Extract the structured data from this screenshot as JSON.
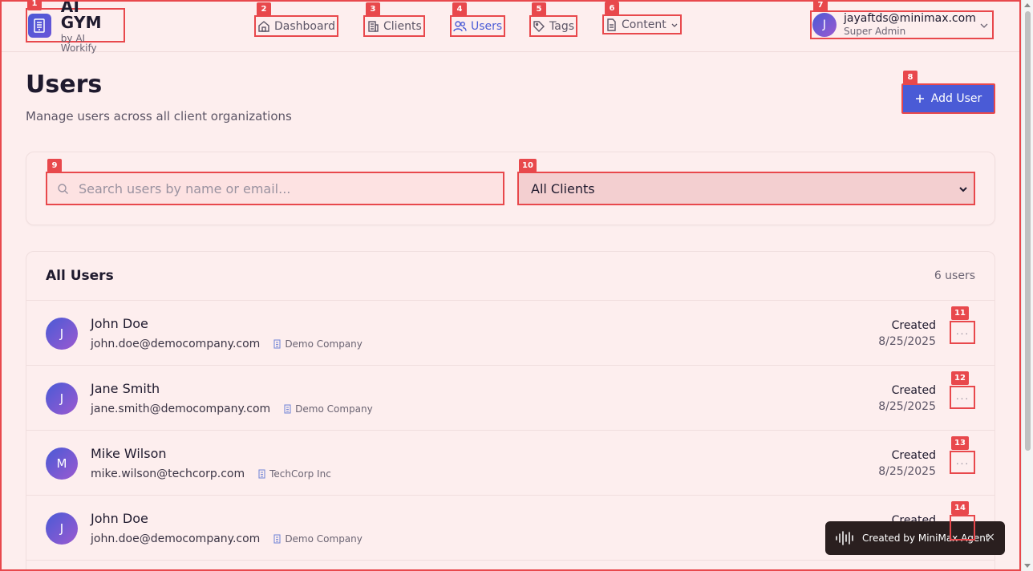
{
  "brand": {
    "title": "AI GYM",
    "subtitle": "by AI Workify"
  },
  "nav": [
    {
      "label": "Dashboard",
      "icon": "home-icon"
    },
    {
      "label": "Clients",
      "icon": "building-icon"
    },
    {
      "label": "Users",
      "icon": "users-icon",
      "active": true
    },
    {
      "label": "Tags",
      "icon": "tag-icon"
    },
    {
      "label": "Content",
      "icon": "document-icon"
    }
  ],
  "user": {
    "initial": "J",
    "email": "jayaftds@minimax.com",
    "role": "Super Admin"
  },
  "page": {
    "title": "Users",
    "subtitle": "Manage users across all client organizations",
    "add_button": "Add User"
  },
  "filters": {
    "search_placeholder": "Search users by name or email...",
    "client_select": "All Clients"
  },
  "users_card": {
    "title": "All Users",
    "count": "6 users",
    "created_label": "Created",
    "rows": [
      {
        "initial": "J",
        "name": "John Doe",
        "email": "john.doe@democompany.com",
        "company": "Demo Company",
        "date": "8/25/2025"
      },
      {
        "initial": "J",
        "name": "Jane Smith",
        "email": "jane.smith@democompany.com",
        "company": "Demo Company",
        "date": "8/25/2025"
      },
      {
        "initial": "M",
        "name": "Mike Wilson",
        "email": "mike.wilson@techcorp.com",
        "company": "TechCorp Inc",
        "date": "8/25/2025"
      },
      {
        "initial": "J",
        "name": "John Doe",
        "email": "john.doe@democompany.com",
        "company": "Demo Company",
        "date": ""
      }
    ]
  },
  "toast": {
    "text": "Created by MiniMax Agent",
    "close": "×"
  },
  "badges": [
    "1",
    "2",
    "3",
    "4",
    "5",
    "6",
    "7",
    "8",
    "9",
    "10",
    "11",
    "12",
    "13",
    "14"
  ],
  "colors": {
    "accent": "#4a5bd6",
    "highlight": "#e8484c",
    "background": "#fdeeee"
  }
}
